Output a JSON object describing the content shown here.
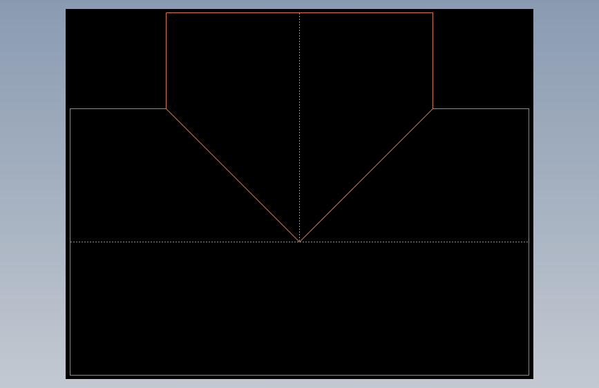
{
  "canvas": {
    "background_color": "#000000"
  },
  "drawing": {
    "outline_color": "#e0742a",
    "centerline_color": "#bfbfbf"
  }
}
